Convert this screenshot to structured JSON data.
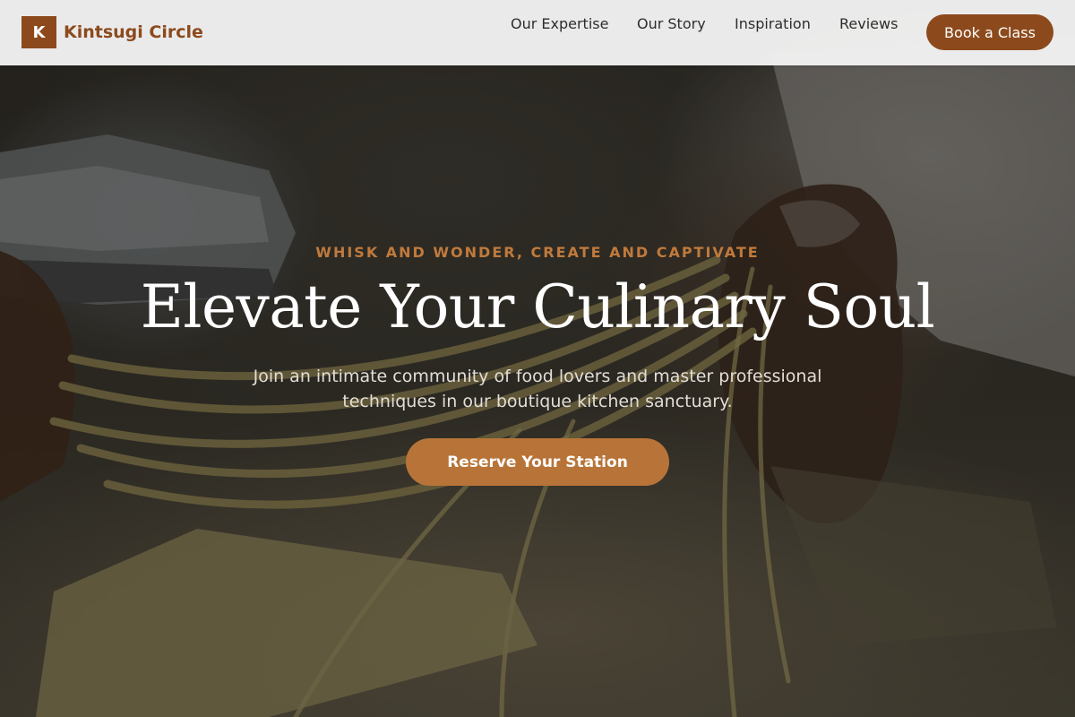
{
  "header": {
    "logo_letter": "K",
    "brand_name": "Kintsugi Circle",
    "nav": [
      {
        "label": "Our Expertise"
      },
      {
        "label": "Our Story"
      },
      {
        "label": "Inspiration"
      },
      {
        "label": "Reviews"
      }
    ],
    "cta_label": "Book a Class"
  },
  "hero": {
    "eyebrow": "WHISK AND WONDER, CREATE AND CAPTIVATE",
    "headline": "Elevate Your Culinary Soul",
    "subtext": "Join an intimate community of food lovers and master professional techniques in our boutique kitchen sanctuary.",
    "cta_label": "Reserve Your Station",
    "image_subject": "hands feeding fresh pasta through a pasta machine"
  },
  "colors": {
    "brand": "#8c4a1c",
    "accent": "#b87438",
    "eyebrow": "#c07a3c",
    "header_bg": "#f2f2f2"
  }
}
